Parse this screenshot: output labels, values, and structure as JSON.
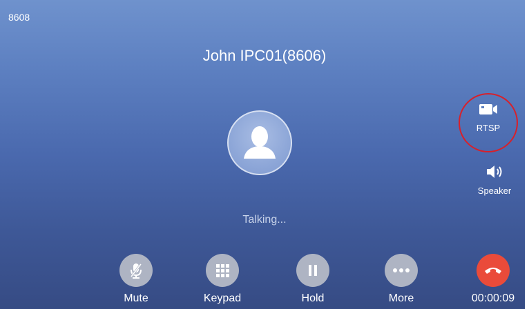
{
  "status_bar": {
    "extension": "8608"
  },
  "call": {
    "caller_name": "John IPC01(8606)",
    "state": "Talking..."
  },
  "side_actions": {
    "rtsp_label": "RTSP",
    "speaker_label": "Speaker"
  },
  "actions": [
    {
      "label": "Mute",
      "icon": "mic-mute-icon"
    },
    {
      "label": "Keypad",
      "icon": "keypad-icon"
    },
    {
      "label": "Hold",
      "icon": "pause-icon"
    },
    {
      "label": "More",
      "icon": "more-dots-icon"
    },
    {
      "label": "00:00:09",
      "icon": "end-call-icon"
    }
  ],
  "colors": {
    "end_call": "#ea4b3a",
    "highlight_ring": "#d8202a",
    "action_button": "#aeb4c3"
  }
}
